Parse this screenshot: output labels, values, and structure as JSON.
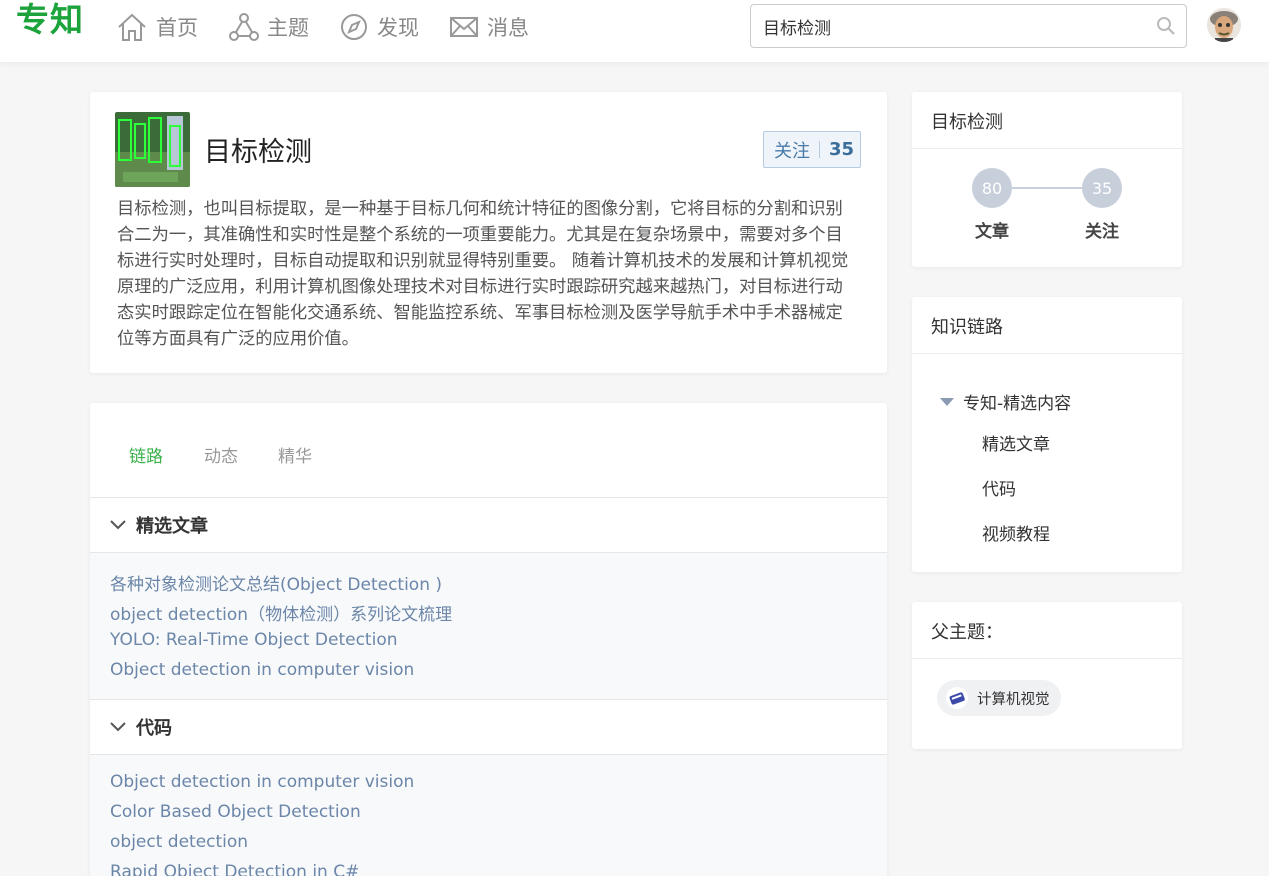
{
  "header": {
    "logo": "专知",
    "nav": [
      {
        "label": "首页",
        "icon": "home-icon"
      },
      {
        "label": "主题",
        "icon": "topic-icon"
      },
      {
        "label": "发现",
        "icon": "compass-icon"
      },
      {
        "label": "消息",
        "icon": "mail-icon"
      }
    ],
    "search": {
      "value": "目标检测",
      "placeholder": ""
    },
    "avatar": "user-avatar"
  },
  "topic": {
    "title": "目标检测",
    "follow_label": "关注",
    "follow_count": "35",
    "description": "目标检测，也叫目标提取，是一种基于目标几何和统计特征的图像分割，它将目标的分割和识别合二为一，其准确性和实时性是整个系统的一项重要能力。尤其是在复杂场景中，需要对多个目标进行实时处理时，目标自动提取和识别就显得特别重要。 随着计算机技术的发展和计算机视觉原理的广泛应用，利用计算机图像处理技术对目标进行实时跟踪研究越来越热门，对目标进行动态实时跟踪定位在智能化交通系统、智能监控系统、军事目标检测及医学导航手术中手术器械定位等方面具有广泛的应用价值。"
  },
  "tabs": [
    {
      "label": "链路",
      "active": true
    },
    {
      "label": "动态",
      "active": false
    },
    {
      "label": "精华",
      "active": false
    }
  ],
  "sections": [
    {
      "title": "精选文章",
      "items": [
        "各种对象检测论文总结(Object Detection )",
        "object detection（物体检测）系列论文梳理",
        "YOLO: Real-Time Object Detection",
        "Object detection in computer vision"
      ]
    },
    {
      "title": "代码",
      "items": [
        "Object detection in computer vision",
        "Color Based Object Detection",
        "object detection",
        "Rapid Object Detection in C#"
      ]
    }
  ],
  "sidebar": {
    "stats": {
      "title": "目标检测",
      "articles_count": "80",
      "articles_label": "文章",
      "followers_count": "35",
      "followers_label": "关注"
    },
    "knowledge": {
      "title": "知识链路",
      "root": "专知-精选内容",
      "children": [
        "精选文章",
        "代码",
        "视频教程"
      ]
    },
    "parent": {
      "title": "父主题：",
      "tag": "计算机视觉"
    }
  },
  "colors": {
    "brand_green": "#1da33c",
    "tab_active": "#3cb04a",
    "link_blue": "#6b86a8",
    "follow_blue": "#3a6d9a"
  }
}
